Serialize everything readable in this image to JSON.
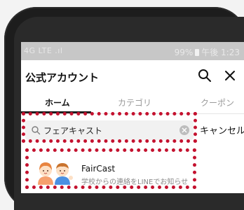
{
  "status_bar": {
    "left": "4G LTE .ıl",
    "battery": "99%",
    "time": "午後 1:23"
  },
  "header": {
    "title": "公式アカウント"
  },
  "tabs": [
    {
      "label": "ホーム",
      "active": true
    },
    {
      "label": "カテゴリ",
      "active": false
    },
    {
      "label": "クーポン",
      "active": false
    }
  ],
  "search": {
    "value": "フェアキャスト",
    "cancel_label": "キャンセル"
  },
  "result": {
    "name": "FairCast",
    "description": "学校からの連絡をLINEでお知らせ"
  },
  "colors": {
    "highlight": "#c4122f",
    "tab_active": "#111111"
  }
}
